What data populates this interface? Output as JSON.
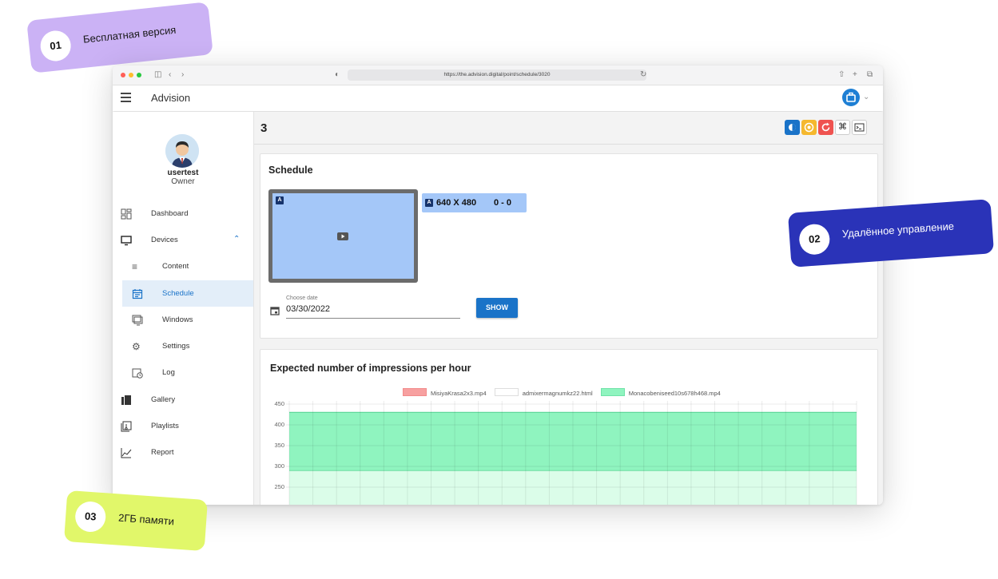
{
  "labels": [
    {
      "num": "01",
      "text": "Бесплатная версия",
      "color": "#cbb2f5",
      "text_color": "#1a1a1a"
    },
    {
      "num": "02",
      "text": "Удалённое управление",
      "color": "#2a33b8",
      "text_color": "#ffffff"
    },
    {
      "num": "03",
      "text": "2ГБ памяти",
      "color": "#e1f76a",
      "text_color": "#1a1a1a"
    }
  ],
  "browser": {
    "url": "https://the.advision.digital/point/schedule/3020"
  },
  "appbar": {
    "title": "Advision",
    "user_button_color": "#1e7fd4"
  },
  "sidebar": {
    "user_name": "usertest",
    "user_role": "Owner",
    "items": [
      {
        "label": "Dashboard",
        "icon": "dashboard-icon"
      },
      {
        "label": "Devices",
        "icon": "monitor-icon",
        "expanded": true
      },
      {
        "label": "Content",
        "icon": "playlist-add-icon"
      },
      {
        "label": "Schedule",
        "icon": "calendar-icon",
        "active": true
      },
      {
        "label": "Windows",
        "icon": "windows-icon"
      },
      {
        "label": "Settings",
        "icon": "gear-icon"
      },
      {
        "label": "Log",
        "icon": "history-icon"
      },
      {
        "label": "Gallery",
        "icon": "gallery-icon"
      },
      {
        "label": "Playlists",
        "icon": "playlist-icon"
      },
      {
        "label": "Report",
        "icon": "chart-line-icon"
      }
    ]
  },
  "page": {
    "title": "3",
    "toolbar_buttons": [
      {
        "icon": "brightness-icon",
        "color": "#1a73c8"
      },
      {
        "icon": "record-icon",
        "color": "#f5b82e"
      },
      {
        "icon": "refresh-icon",
        "color": "#ef5350"
      },
      {
        "icon": "command-icon",
        "color": "#ffffff"
      },
      {
        "icon": "terminal-icon",
        "color": "#ffffff"
      }
    ]
  },
  "schedule": {
    "title": "Schedule",
    "zone_letter": "A",
    "zone_resolution": "640 X 480",
    "zone_offset": "0 - 0",
    "date_label": "Choose date",
    "date_value": "03/30/2022",
    "show_button": "SHOW"
  },
  "chart_data": {
    "type": "area",
    "title": "Expected number of impressions per hour",
    "series": [
      {
        "name": "MisiyaKrasa2x3.mp4",
        "color": "#f7a0a0",
        "values": []
      },
      {
        "name": "admixermagnumkz22.html",
        "color": "#ffffff",
        "values": []
      },
      {
        "name": "Monacobeniseed10s678h468.mp4",
        "color": "#8ff4bf",
        "values": [
          430,
          430,
          430,
          430,
          430,
          430,
          430,
          430,
          430,
          430,
          430,
          430,
          430,
          430,
          430,
          430,
          430,
          430,
          430,
          430,
          430,
          430,
          430,
          430
        ]
      }
    ],
    "band_level": 290,
    "y_ticks": [
      450,
      400,
      350,
      300,
      250
    ],
    "ylim": [
      250,
      450
    ],
    "legend_position": "top",
    "grid": true
  }
}
